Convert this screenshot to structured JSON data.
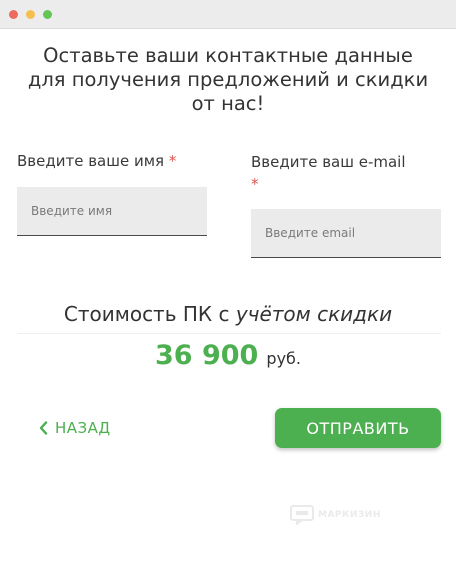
{
  "window": {
    "controls": [
      "close",
      "minimize",
      "maximize"
    ],
    "colors": {
      "close": "#ee6a5f",
      "minimize": "#f5be4f",
      "maximize": "#62c554"
    }
  },
  "form": {
    "heading_lines": [
      "Оставьте ваши контактные данные",
      "для получения предложений и скидки",
      "от нас!"
    ],
    "name_field": {
      "label": "Введите ваше имя",
      "required_mark": "*",
      "placeholder": "Введите имя",
      "value": ""
    },
    "email_field": {
      "label": "Введите ваш e-mail",
      "required_mark": "*",
      "placeholder": "Введите email",
      "value": ""
    }
  },
  "price": {
    "title_prefix": "Стоимость ПК с ",
    "title_emphasis": "учётом скидки",
    "value": "36 900",
    "currency": "руб."
  },
  "actions": {
    "back_label": "НАЗАД",
    "back_icon": "chevron-left-icon",
    "submit_label": "ОТПРАВИТЬ"
  },
  "watermark": {
    "icon": "logo-icon",
    "text": "МАРКИЗИН"
  },
  "colors": {
    "accent": "#4caf50",
    "required": "#d9534f",
    "input_bg": "#ebebeb"
  }
}
